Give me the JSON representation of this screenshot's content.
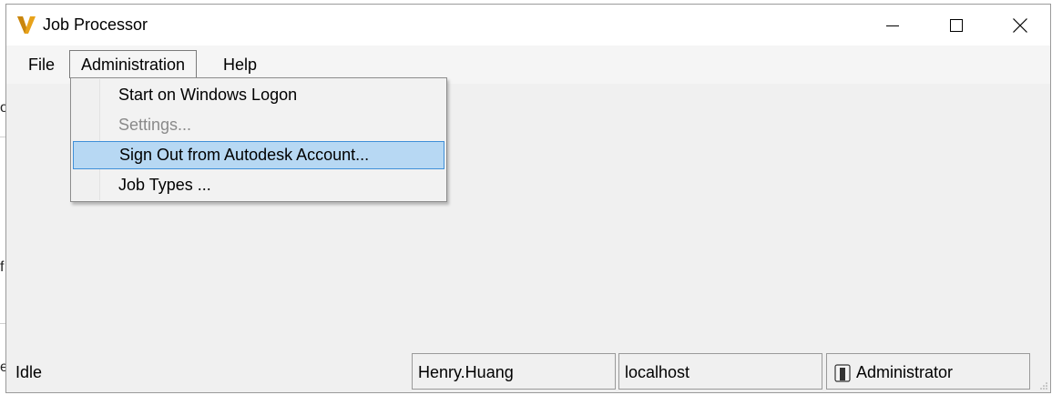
{
  "window": {
    "title": "Job Processor",
    "icon": "autodesk-vault-icon",
    "brand_color": "#e8a21a"
  },
  "title_buttons": {
    "minimize_icon": "minimize-icon",
    "maximize_icon": "maximize-icon",
    "close_icon": "close-icon"
  },
  "menubar": {
    "items": [
      {
        "label": "File"
      },
      {
        "label": "Administration"
      },
      {
        "label": "Help"
      }
    ]
  },
  "dropdown": {
    "items": [
      {
        "label": "Start on Windows Logon",
        "state": "enabled"
      },
      {
        "label": "Settings...",
        "state": "disabled"
      },
      {
        "label": "Sign Out from Autodesk Account...",
        "state": "highlighted"
      },
      {
        "label": "Job Types ...",
        "state": "enabled"
      }
    ],
    "highlight_color": "#b7d8f3"
  },
  "statusbar": {
    "status": "Idle",
    "user": "Henry.Huang",
    "host": "localhost",
    "role": "Administrator",
    "role_icon": "user-role-icon"
  },
  "background_fragments": {
    "frag1": "o",
    "frag2": "f",
    "frag3": "e"
  }
}
